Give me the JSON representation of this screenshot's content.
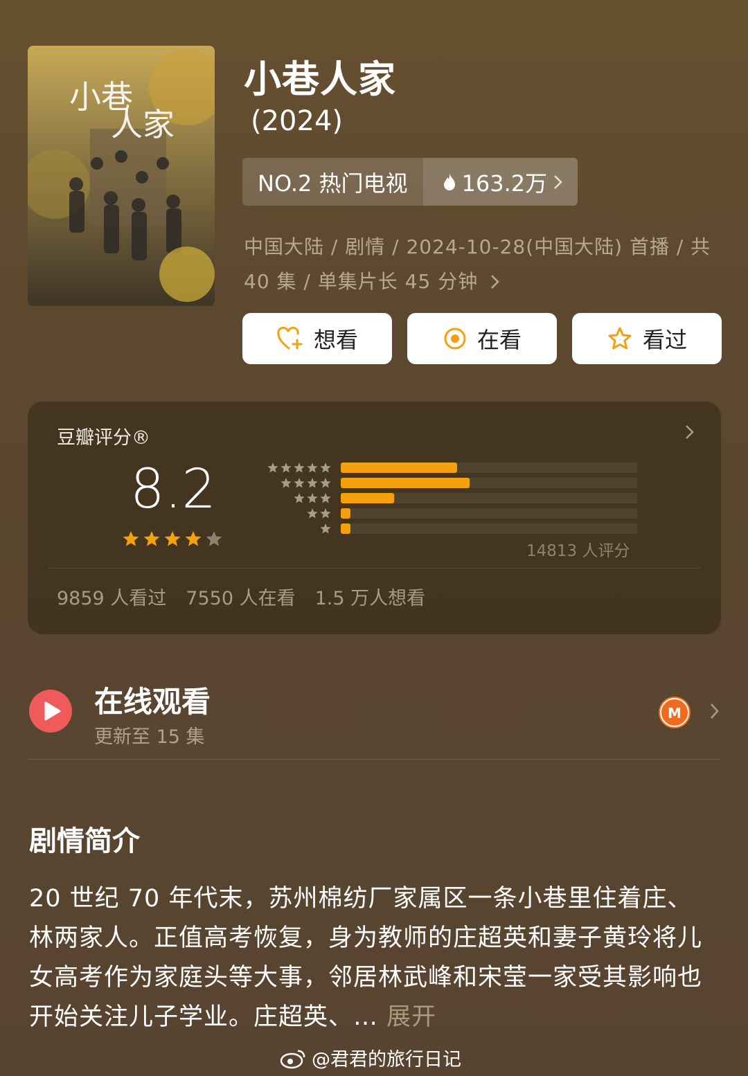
{
  "show": {
    "title": "小巷人家",
    "year": "(2024)",
    "rank_label": "NO.2 热门电视",
    "heat_value": "163.2万",
    "meta_line1": "中国大陆 / 剧情 / 2024-10-28(中国大陆) 首播 / 共",
    "meta_line2": "40 集 / 单集片长 45 分钟"
  },
  "actions": {
    "want": "想看",
    "watching": "在看",
    "watched": "看过"
  },
  "rating": {
    "label": "豆瓣评分®",
    "score": "8.2",
    "stars_value": 4,
    "distribution": [
      37,
      41,
      17,
      3,
      3
    ],
    "count": "14813 人评分",
    "stats": [
      "9859 人看过",
      "7550 人在看",
      "1.5 万人想看"
    ]
  },
  "online": {
    "title": "在线观看",
    "subtitle": "更新至 15 集"
  },
  "synopsis": {
    "title": "剧情简介",
    "body": "20 世纪 70 年代末，苏州棉纺厂家属区一条小巷里住着庄、林两家人。正值高考恢复，身为教师的庄超英和妻子黄玲将儿女高考作为家庭头等大事，邻居林武峰和宋莹一家受其影响也开始关注儿子学业。庄超英、…",
    "more": "展开"
  },
  "watermark": "@君君的旅行日记",
  "colors": {
    "accent_orange": "#f5a00d",
    "play_red": "#ef5b5b"
  }
}
